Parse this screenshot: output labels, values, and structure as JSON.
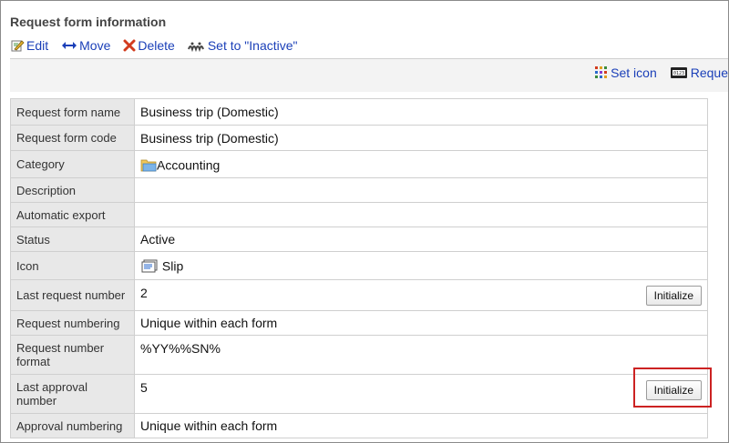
{
  "page_title": "Request form information",
  "actions": [
    {
      "icon": "edit-icon",
      "label": "Edit"
    },
    {
      "icon": "move-icon",
      "label": "Move"
    },
    {
      "icon": "delete-icon",
      "label": "Delete"
    },
    {
      "icon": "inactive-icon",
      "label": "Set to \"Inactive\""
    }
  ],
  "subbar": {
    "set_icon": "Set icon",
    "request": "Reque"
  },
  "rows": [
    {
      "label": "Request form name",
      "value": "Business trip (Domestic)"
    },
    {
      "label": "Request form code",
      "value": "Business trip (Domestic)"
    },
    {
      "label": "Category",
      "value": "Accounting"
    },
    {
      "label": "Description",
      "value": ""
    },
    {
      "label": "Automatic export",
      "value": ""
    },
    {
      "label": "Status",
      "value": "Active"
    },
    {
      "label": "Icon",
      "value": "Slip"
    },
    {
      "label": "Last request number",
      "value": "2",
      "button": "Initialize"
    },
    {
      "label": "Request numbering",
      "value": "Unique within each form"
    },
    {
      "label": "Request number format",
      "value": "%YY%%SN%"
    },
    {
      "label": "Last approval number",
      "value": "5",
      "button": "Initialize"
    },
    {
      "label": "Approval numbering",
      "value": "Unique within each form"
    }
  ],
  "colors": {
    "link": "#1a3fb8",
    "status_active": "#0a7a0a",
    "highlight": "#cc2222",
    "label_bg": "#e8e8e8"
  }
}
